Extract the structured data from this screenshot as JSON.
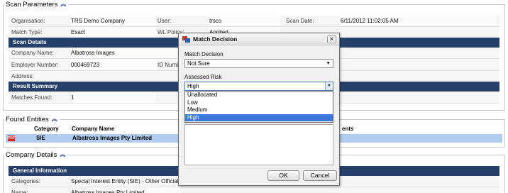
{
  "scan_parameters": {
    "legend": "Scan Parameters",
    "organisation_label": "Organisation:",
    "organisation_value": "TRS Demo Company",
    "user_label": "User:",
    "user_value": "trsco",
    "scan_date_label": "Scan Date:",
    "scan_date_value": "6/11/2012 11:02:05 AM",
    "match_type_label": "Match Type:",
    "match_type_value": "Exact",
    "wl_policy_label": "WL Policy:",
    "wl_policy_value": "Applied"
  },
  "scan_details": {
    "header": "Scan Details",
    "company_name_label": "Company Name:",
    "company_name_value": "Albatross Images",
    "employer_number_label": "Employer Number:",
    "employer_number_value": "000469723",
    "id_number_label": "ID Number:",
    "address_label": "Address:"
  },
  "result_summary": {
    "header": "Result Summary",
    "matches_found_label": "Matches Found:",
    "matches_found_value": "1"
  },
  "found_entities": {
    "legend": "Found Entities",
    "columns": [
      "Category",
      "Company Name",
      "ents"
    ],
    "rows": [
      {
        "icon": "pdf-icon",
        "icon_text": "PDF",
        "category": "SIE",
        "company_name": "Albatross Images Pty Limited"
      }
    ]
  },
  "company_details": {
    "legend": "Company Details",
    "header": "General Information",
    "categories_label": "Categories:",
    "categories_value": "Special Interest Entity (SIE) - Other Official L",
    "name_label": "Name:",
    "name_value": "Albatross Images Pty Limited"
  },
  "dialog": {
    "title": "Match Decision",
    "close_glyph": "✕",
    "match_decision_label": "Match Decision",
    "match_decision_value": "Not Sure",
    "assessed_risk_label": "Assessed Risk",
    "assessed_risk_value": "High",
    "risk_options": [
      "Unallocated",
      "Low",
      "Medium",
      "High"
    ],
    "selected_option": "High",
    "ok_label": "OK",
    "cancel_label": "Cancel"
  },
  "colors": {
    "section_header": "#26406a",
    "selected_row": "#b2ccef",
    "listbox_highlight": "#3c78d8"
  }
}
